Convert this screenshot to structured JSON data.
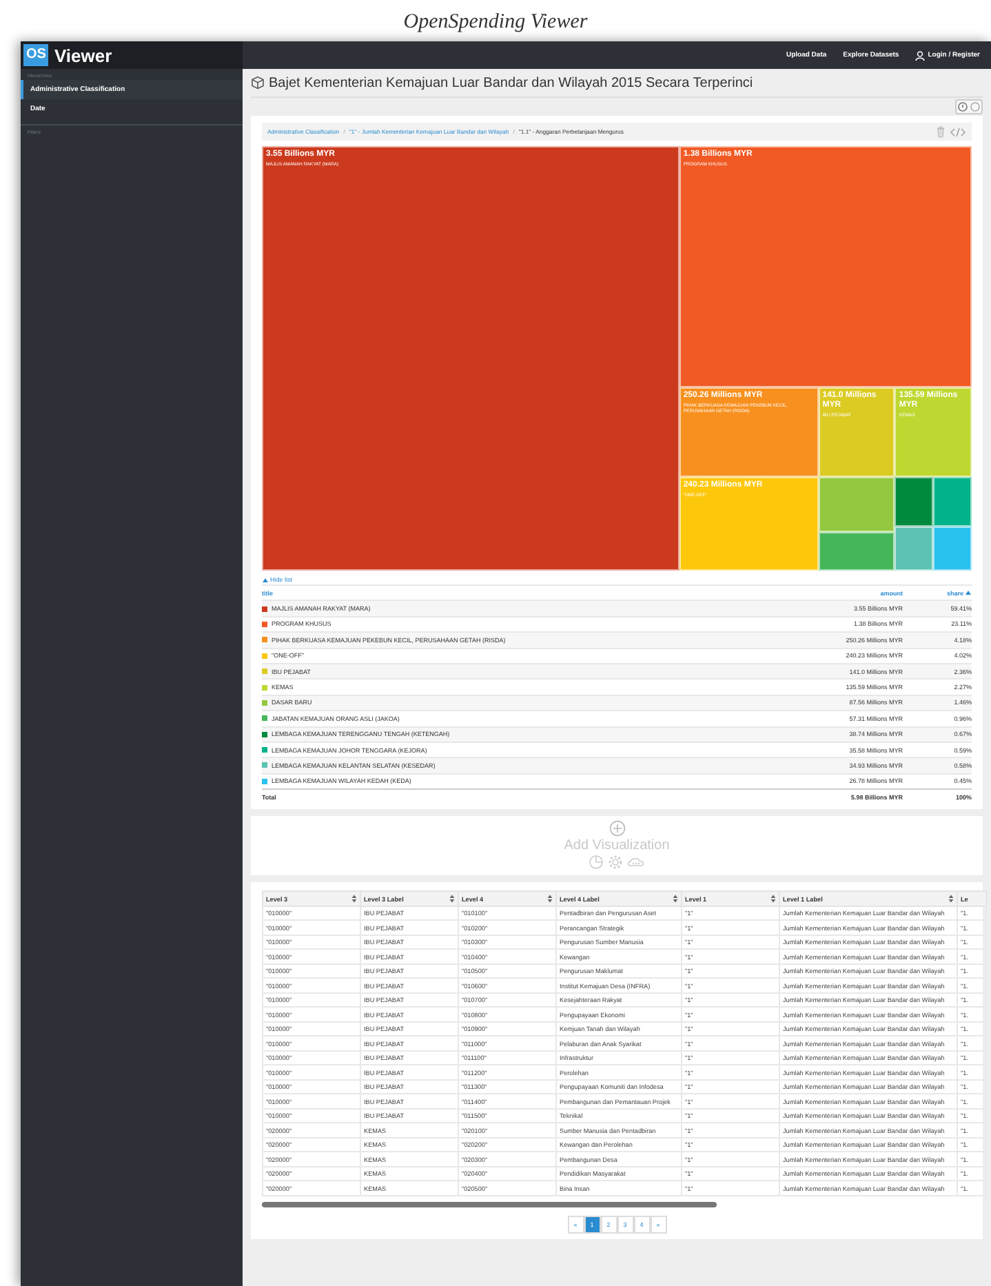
{
  "caption": "OpenSpending Viewer",
  "app": {
    "logo_badge": "OS",
    "logo_text": "Viewer"
  },
  "topbar": {
    "links": [
      "Upload Data",
      "Explore Datasets"
    ],
    "login": "Login / Register"
  },
  "sidebar": {
    "hierarchies_label": "Hierarchies",
    "items": [
      {
        "label": "Administrative Classification",
        "selected": true
      },
      {
        "label": "Date",
        "selected": false
      }
    ],
    "filters_label": "Filters"
  },
  "title": "Bajet Kementerian Kemajuan Luar Bandar dan Wilayah 2015 Secara Terperinci",
  "breadcrumb_separator": "/",
  "breadcrumbs": [
    {
      "label": "Administrative Classification",
      "link": true
    },
    {
      "label": "\"1\" - Jumlah Kementerian Kemajuan Luar Bandar dan Wilayah",
      "link": true
    },
    {
      "label": "\"1.1\" - Anggaran Perbelanjaan Mengurus",
      "link": false
    }
  ],
  "treemap": [
    {
      "amount": "3.55 Billions MYR",
      "title": "MAJLIS AMANAH RAKYAT (MARA)",
      "color": "#cc3a1e"
    },
    {
      "amount": "1.38 Billions MYR",
      "title": "PROGRAM KHUSUS",
      "color": "#f15a24"
    },
    {
      "amount": "250.26 Millions MYR",
      "title": "PIHAK BERKUASA KEMAJUAN PEKEBUN KECIL, PERUSAHAAN GETAH (RISDA)",
      "color": "#f7901e"
    },
    {
      "amount": "240.23 Millions MYR",
      "title": "\"ONE-OFF\"",
      "color": "#fdc70c"
    },
    {
      "amount": "141.0 Millions MYR",
      "title": "IBU PEJABAT",
      "color": "#dccb23"
    },
    {
      "amount": "135.59 Millions MYR",
      "title": "KEMAS",
      "color": "#bfd730"
    },
    {
      "color": "#94c840"
    },
    {
      "color": "#45b75a"
    },
    {
      "color": "#008a3e"
    },
    {
      "color": "#00b38a"
    },
    {
      "color": "#5cc2b1"
    },
    {
      "color": "#29c1ee"
    }
  ],
  "legend": {
    "toggle": "Hide list",
    "columns": [
      {
        "label": "title",
        "sorted": false
      },
      {
        "label": "amount",
        "sorted": false
      },
      {
        "label": "share",
        "sorted": true
      }
    ],
    "rows": [
      {
        "color": "#cc3a1e",
        "title": "MAJLIS AMANAH RAKYAT (MARA)",
        "amount": "3.55 Billions MYR",
        "share": "59.41%"
      },
      {
        "color": "#f15a24",
        "title": "PROGRAM KHUSUS",
        "amount": "1.38 Billions MYR",
        "share": "23.11%"
      },
      {
        "color": "#f7901e",
        "title": "PIHAK BERKUASA KEMAJUAN PEKEBUN KECIL, PERUSAHAAN GETAH (RISDA)",
        "amount": "250.26 Millions MYR",
        "share": "4.18%"
      },
      {
        "color": "#fdc70c",
        "title": "\"ONE-OFF\"",
        "amount": "240.23 Millions MYR",
        "share": "4.02%"
      },
      {
        "color": "#dccb23",
        "title": "IBU PEJABAT",
        "amount": "141.0 Millions MYR",
        "share": "2.36%"
      },
      {
        "color": "#bfd730",
        "title": "KEMAS",
        "amount": "135.59 Millions MYR",
        "share": "2.27%"
      },
      {
        "color": "#94c840",
        "title": "DASAR BARU",
        "amount": "87.56 Millions MYR",
        "share": "1.46%"
      },
      {
        "color": "#45b75a",
        "title": "JABATAN KEMAJUAN ORANG ASLI (JAKOA)",
        "amount": "57.31 Millions MYR",
        "share": "0.96%"
      },
      {
        "color": "#008a3e",
        "title": "LEMBAGA KEMAJUAN TERENGGANU TENGAH (KETENGAH)",
        "amount": "38.74 Millions MYR",
        "share": "0.67%"
      },
      {
        "color": "#00b38a",
        "title": "LEMBAGA KEMAJUAN JOHOR TENGGARA (KEJORA)",
        "amount": "35.58 Millions MYR",
        "share": "0.59%"
      },
      {
        "color": "#5cc2b1",
        "title": "LEMBAGA KEMAJUAN KELANTAN SELATAN (KESEDAR)",
        "amount": "34.93 Millions MYR",
        "share": "0.58%"
      },
      {
        "color": "#29c1ee",
        "title": "LEMBAGA KEMAJUAN WILAYAH KEDAH (KEDA)",
        "amount": "26.78 Millions MYR",
        "share": "0.45%"
      }
    ],
    "total": {
      "label": "Total",
      "amount": "5.98 Billions MYR",
      "share": "100%"
    }
  },
  "add_visualization": {
    "label": "Add Visualization"
  },
  "data_table": {
    "columns": [
      "Level 3",
      "Level 3 Label",
      "Level 4",
      "Level 4 Label",
      "Level 1",
      "Level 1 Label",
      "Le"
    ],
    "rows": [
      [
        "\"010000\"",
        "IBU PEJABAT",
        "\"010100\"",
        "Pentadbiran dan Pengurusan Aset",
        "\"1\"",
        "Jumlah Kementerian Kemajuan Luar Bandar dan Wilayah",
        "\"1."
      ],
      [
        "\"010000\"",
        "IBU PEJABAT",
        "\"010200\"",
        "Perancangan Strategik",
        "\"1\"",
        "Jumlah Kementerian Kemajuan Luar Bandar dan Wilayah",
        "\"1."
      ],
      [
        "\"010000\"",
        "IBU PEJABAT",
        "\"010300\"",
        "Pengurusan Sumber Manusia",
        "\"1\"",
        "Jumlah Kementerian Kemajuan Luar Bandar dan Wilayah",
        "\"1."
      ],
      [
        "\"010000\"",
        "IBU PEJABAT",
        "\"010400\"",
        "Kewangan",
        "\"1\"",
        "Jumlah Kementerian Kemajuan Luar Bandar dan Wilayah",
        "\"1."
      ],
      [
        "\"010000\"",
        "IBU PEJABAT",
        "\"010500\"",
        "Pengurusan Maklumat",
        "\"1\"",
        "Jumlah Kementerian Kemajuan Luar Bandar dan Wilayah",
        "\"1."
      ],
      [
        "\"010000\"",
        "IBU PEJABAT",
        "\"010600\"",
        "Institut Kemajuan Desa (INFRA)",
        "\"1\"",
        "Jumlah Kementerian Kemajuan Luar Bandar dan Wilayah",
        "\"1."
      ],
      [
        "\"010000\"",
        "IBU PEJABAT",
        "\"010700\"",
        "Kesejahteraan Rakyat",
        "\"1\"",
        "Jumlah Kementerian Kemajuan Luar Bandar dan Wilayah",
        "\"1."
      ],
      [
        "\"010000\"",
        "IBU PEJABAT",
        "\"010800\"",
        "Pengupayaan Ekonomi",
        "\"1\"",
        "Jumlah Kementerian Kemajuan Luar Bandar dan Wilayah",
        "\"1."
      ],
      [
        "\"010000\"",
        "IBU PEJABAT",
        "\"010900\"",
        "Kemjuan Tanah dan Wilayah",
        "\"1\"",
        "Jumlah Kementerian Kemajuan Luar Bandar dan Wilayah",
        "\"1."
      ],
      [
        "\"010000\"",
        "IBU PEJABAT",
        "\"011000\"",
        "Pelaburan dan Anak Syarikat",
        "\"1\"",
        "Jumlah Kementerian Kemajuan Luar Bandar dan Wilayah",
        "\"1."
      ],
      [
        "\"010000\"",
        "IBU PEJABAT",
        "\"011100\"",
        "Infrastruktur",
        "\"1\"",
        "Jumlah Kementerian Kemajuan Luar Bandar dan Wilayah",
        "\"1."
      ],
      [
        "\"010000\"",
        "IBU PEJABAT",
        "\"011200\"",
        "Perolehan",
        "\"1\"",
        "Jumlah Kementerian Kemajuan Luar Bandar dan Wilayah",
        "\"1."
      ],
      [
        "\"010000\"",
        "IBU PEJABAT",
        "\"011300\"",
        "Pengupayaan Komuniti dan Infodesa",
        "\"1\"",
        "Jumlah Kementerian Kemajuan Luar Bandar dan Wilayah",
        "\"1."
      ],
      [
        "\"010000\"",
        "IBU PEJABAT",
        "\"011400\"",
        "Pembangunan dan Pemantauan Projek",
        "\"1\"",
        "Jumlah Kementerian Kemajuan Luar Bandar dan Wilayah",
        "\"1."
      ],
      [
        "\"010000\"",
        "IBU PEJABAT",
        "\"011500\"",
        "Teknikal",
        "\"1\"",
        "Jumlah Kementerian Kemajuan Luar Bandar dan Wilayah",
        "\"1."
      ],
      [
        "\"020000\"",
        "KEMAS",
        "\"020100\"",
        "Sumber Manusia dan Pentadbiran",
        "\"1\"",
        "Jumlah Kementerian Kemajuan Luar Bandar dan Wilayah",
        "\"1."
      ],
      [
        "\"020000\"",
        "KEMAS",
        "\"020200\"",
        "Kewangan dan Perolehan",
        "\"1\"",
        "Jumlah Kementerian Kemajuan Luar Bandar dan Wilayah",
        "\"1."
      ],
      [
        "\"020000\"",
        "KEMAS",
        "\"020300\"",
        "Pembangunan Desa",
        "\"1\"",
        "Jumlah Kementerian Kemajuan Luar Bandar dan Wilayah",
        "\"1."
      ],
      [
        "\"020000\"",
        "KEMAS",
        "\"020400\"",
        "Pendidikan Masyarakat",
        "\"1\"",
        "Jumlah Kementerian Kemajuan Luar Bandar dan Wilayah",
        "\"1."
      ],
      [
        "\"020000\"",
        "KEMAS",
        "\"020500\"",
        "Bina Insan",
        "\"1\"",
        "Jumlah Kementerian Kemajuan Luar Bandar dan Wilayah",
        "\"1."
      ]
    ]
  },
  "pagination": {
    "prev": "«",
    "next": "»",
    "pages": [
      {
        "label": "1",
        "selected": true
      },
      {
        "label": "2",
        "selected": false
      },
      {
        "label": "3",
        "selected": false
      },
      {
        "label": "4",
        "selected": false
      }
    ]
  }
}
